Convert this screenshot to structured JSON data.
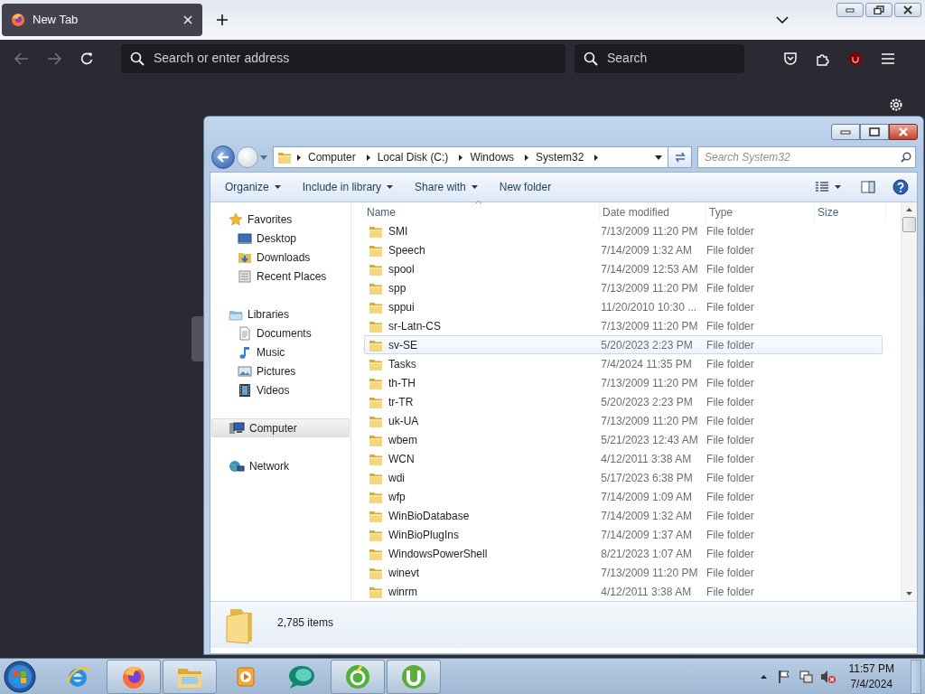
{
  "browser": {
    "tabs": [
      {
        "title": "New Tab",
        "selected": true
      }
    ],
    "address": {
      "placeholder": "Search or enter address"
    },
    "search": {
      "placeholder": "Search"
    }
  },
  "explorer": {
    "breadcrumb": [
      "Computer",
      "Local Disk (C:)",
      "Windows",
      "System32"
    ],
    "search": {
      "placeholder": "Search System32"
    },
    "toolbar": [
      {
        "label": "Organize",
        "dropdown": true
      },
      {
        "label": "Include in library",
        "dropdown": true
      },
      {
        "label": "Share with",
        "dropdown": true
      },
      {
        "label": "New folder",
        "dropdown": false
      }
    ],
    "navigation": [
      {
        "label": "Favorites",
        "kind": "favorites",
        "selected": false,
        "children": [
          {
            "label": "Desktop",
            "kind": "desktop",
            "selected": false
          },
          {
            "label": "Downloads",
            "kind": "downloads",
            "selected": false
          },
          {
            "label": "Recent Places",
            "kind": "recent",
            "selected": false
          }
        ]
      },
      {
        "label": "Libraries",
        "kind": "libraries",
        "selected": false,
        "children": [
          {
            "label": "Documents",
            "kind": "documents",
            "selected": false
          },
          {
            "label": "Music",
            "kind": "music",
            "selected": false
          },
          {
            "label": "Pictures",
            "kind": "pictures",
            "selected": false
          },
          {
            "label": "Videos",
            "kind": "videos",
            "selected": false
          }
        ]
      },
      {
        "label": "Computer",
        "kind": "computer",
        "selected": true
      },
      {
        "label": "Network",
        "kind": "network",
        "selected": false
      }
    ],
    "columns": [
      "Name",
      "Date modified",
      "Type",
      "Size"
    ],
    "rows": [
      {
        "name": "SMI",
        "date": "7/13/2009 11:20 PM",
        "type": "File folder",
        "selected": false
      },
      {
        "name": "Speech",
        "date": "7/14/2009 1:32 AM",
        "type": "File folder",
        "selected": false
      },
      {
        "name": "spool",
        "date": "7/14/2009 12:53 AM",
        "type": "File folder",
        "selected": false
      },
      {
        "name": "spp",
        "date": "7/13/2009 11:20 PM",
        "type": "File folder",
        "selected": false
      },
      {
        "name": "sppui",
        "date": "11/20/2010 10:30 ...",
        "type": "File folder",
        "selected": false
      },
      {
        "name": "sr-Latn-CS",
        "date": "7/13/2009 11:20 PM",
        "type": "File folder",
        "selected": false
      },
      {
        "name": "sv-SE",
        "date": "5/20/2023 2:23 PM",
        "type": "File folder",
        "selected": true
      },
      {
        "name": "Tasks",
        "date": "7/4/2024 11:35 PM",
        "type": "File folder",
        "selected": false
      },
      {
        "name": "th-TH",
        "date": "7/13/2009 11:20 PM",
        "type": "File folder",
        "selected": false
      },
      {
        "name": "tr-TR",
        "date": "5/20/2023 2:23 PM",
        "type": "File folder",
        "selected": false
      },
      {
        "name": "uk-UA",
        "date": "7/13/2009 11:20 PM",
        "type": "File folder",
        "selected": false
      },
      {
        "name": "wbem",
        "date": "5/21/2023 12:43 AM",
        "type": "File folder",
        "selected": false
      },
      {
        "name": "WCN",
        "date": "4/12/2011 3:38 AM",
        "type": "File folder",
        "selected": false
      },
      {
        "name": "wdi",
        "date": "5/17/2023 6:38 PM",
        "type": "File folder",
        "selected": false
      },
      {
        "name": "wfp",
        "date": "7/14/2009 1:09 AM",
        "type": "File folder",
        "selected": false
      },
      {
        "name": "WinBioDatabase",
        "date": "7/14/2009 1:32 AM",
        "type": "File folder",
        "selected": false
      },
      {
        "name": "WinBioPlugIns",
        "date": "7/14/2009 1:37 AM",
        "type": "File folder",
        "selected": false
      },
      {
        "name": "WindowsPowerShell",
        "date": "8/21/2023 1:07 AM",
        "type": "File folder",
        "selected": false
      },
      {
        "name": "winevt",
        "date": "7/13/2009 11:20 PM",
        "type": "File folder",
        "selected": false
      },
      {
        "name": "winrm",
        "date": "4/12/2011 3:38 AM",
        "type": "File folder",
        "selected": false
      }
    ],
    "status": "2,785 items"
  },
  "taskbar": {
    "apps": [
      {
        "kind": "ie",
        "running": false
      },
      {
        "kind": "firefox",
        "running": true
      },
      {
        "kind": "explorer",
        "running": true
      },
      {
        "kind": "media",
        "running": false
      },
      {
        "kind": "bubble",
        "running": false
      },
      {
        "kind": "cleaner",
        "running": true
      },
      {
        "kind": "torrent",
        "running": true
      }
    ],
    "time": "11:57 PM",
    "date": "7/4/2024"
  }
}
